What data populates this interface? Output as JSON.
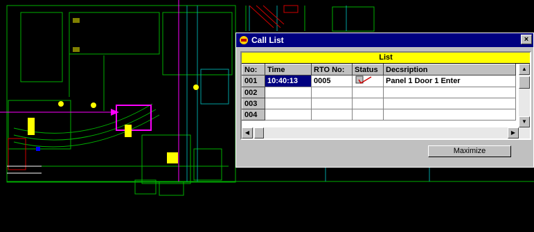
{
  "dialog": {
    "title": "Call List",
    "close_label": "×",
    "grid_header": "List",
    "columns": [
      "No:",
      "Time",
      "RTO No:",
      "Status",
      "Decsription"
    ],
    "rows": [
      {
        "no": "001",
        "time": "10:40:13",
        "rto": "0005",
        "desc": "Panel 1 Door 1 Enter",
        "has_status": true
      },
      {
        "no": "002",
        "time": "",
        "rto": "",
        "desc": "",
        "has_status": false
      },
      {
        "no": "003",
        "time": "",
        "rto": "",
        "desc": "",
        "has_status": false
      },
      {
        "no": "004",
        "time": "",
        "rto": "",
        "desc": "",
        "has_status": false
      }
    ],
    "maximize_label": "Maximize"
  },
  "colors": {
    "titlebar": "#000080",
    "grid_header": "#ffff00",
    "cad_green": "#00c000",
    "cad_cyan": "#00c0c0",
    "cad_magenta": "#ff00ff"
  }
}
